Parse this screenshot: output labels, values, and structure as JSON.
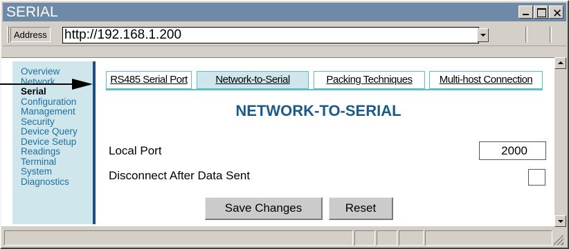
{
  "window": {
    "title": "SERIAL"
  },
  "address": {
    "label": "Address",
    "url": "http://192.168.1.200"
  },
  "sidebar": {
    "items": [
      {
        "label": "Overview",
        "active": false
      },
      {
        "label": "Network",
        "active": false
      },
      {
        "label": "Serial",
        "active": true
      },
      {
        "label": "Configuration",
        "active": false
      },
      {
        "label": "Management",
        "active": false
      },
      {
        "label": "Security",
        "active": false
      },
      {
        "label": "Device Query",
        "active": false
      },
      {
        "label": "Device Setup",
        "active": false
      },
      {
        "label": "Readings",
        "active": false
      },
      {
        "label": "Terminal",
        "active": false
      },
      {
        "label": "System",
        "active": false
      },
      {
        "label": "Diagnostics",
        "active": false
      }
    ]
  },
  "tabs": [
    {
      "label": "RS485 Serial Port",
      "active": false
    },
    {
      "label": "Network-to-Serial",
      "active": true
    },
    {
      "label": "Packing Techniques",
      "active": false
    },
    {
      "label": "Multi-host Connection",
      "active": false
    }
  ],
  "page": {
    "heading": "NETWORK-TO-SERIAL",
    "local_port_label": "Local Port",
    "local_port_value": "2000",
    "disconnect_label": "Disconnect After Data Sent",
    "disconnect_checked": false,
    "save_label": "Save Changes",
    "reset_label": "Reset"
  },
  "colors": {
    "accent": "#1b5b8a",
    "nav_bg": "#cfe7ec",
    "tab_border": "#5ac0c8",
    "title_bar": "#6e8aa6"
  }
}
